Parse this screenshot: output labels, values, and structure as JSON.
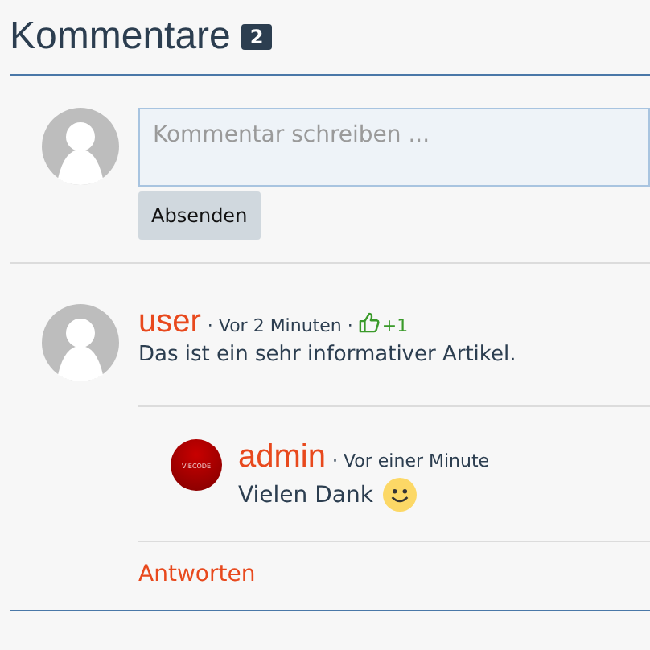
{
  "heading": {
    "title": "Kommentare",
    "count": "2"
  },
  "composer": {
    "placeholder": "Kommentar schreiben ...",
    "submit": "Absenden"
  },
  "comments": [
    {
      "author": "user",
      "meta": "· Vor 2 Minuten ·",
      "likes": "+1",
      "text": "Das ist ein sehr informativer Artikel.",
      "replies": [
        {
          "author": "admin",
          "avatar_text": "VIECODE",
          "meta": "· Vor einer Minute",
          "text": "Vielen Dank",
          "emoji": true
        }
      ],
      "reply_link": "Antworten"
    }
  ]
}
